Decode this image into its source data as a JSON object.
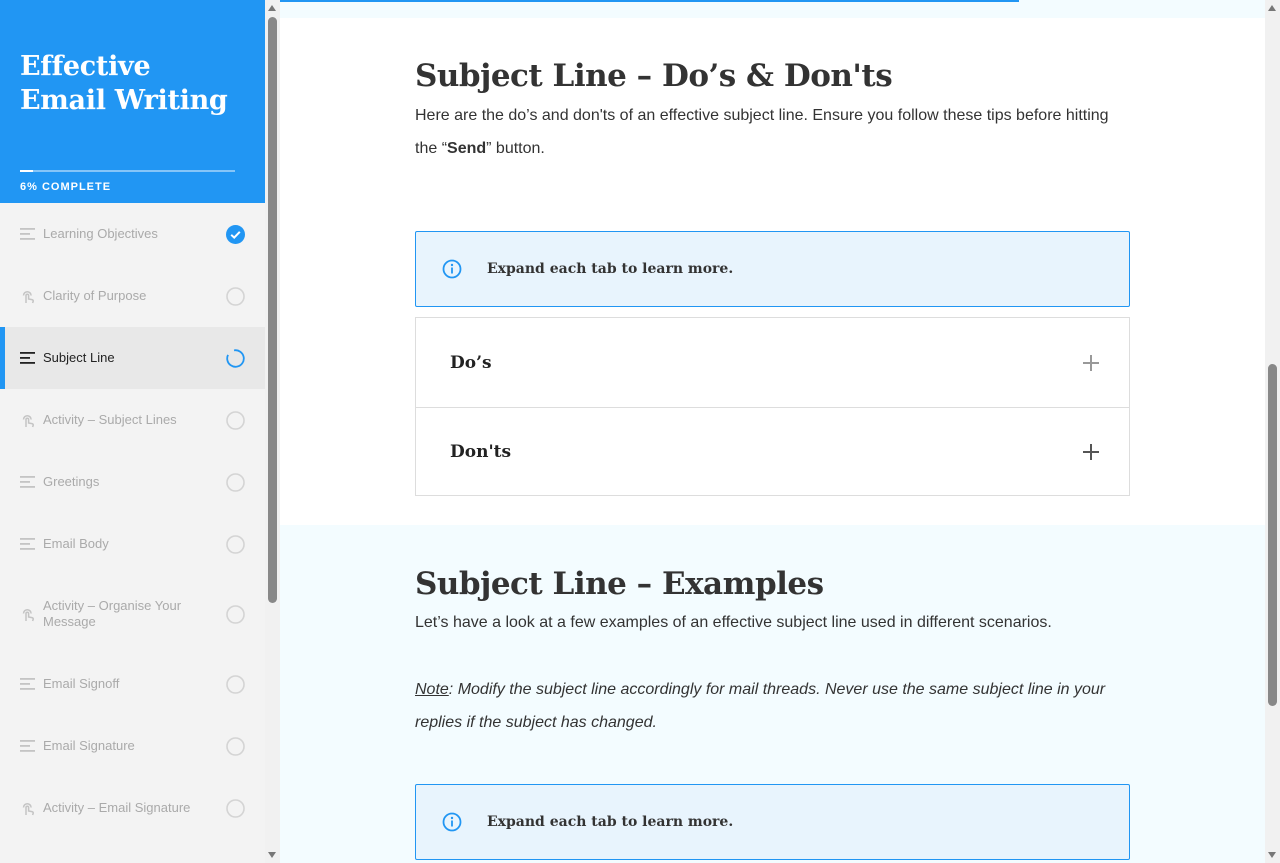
{
  "course": {
    "title": "Effective Email Writing",
    "progress_percent": 6,
    "progress_text": "6% COMPLETE"
  },
  "lessons": [
    {
      "label": "Learning Objectives",
      "type": "text",
      "status": "complete"
    },
    {
      "label": "Clarity of Purpose",
      "type": "activity",
      "status": "incomplete"
    },
    {
      "label": "Subject Line",
      "type": "text",
      "status": "in-progress"
    },
    {
      "label": "Activity – Subject Lines",
      "type": "activity",
      "status": "incomplete"
    },
    {
      "label": "Greetings",
      "type": "text",
      "status": "incomplete"
    },
    {
      "label": "Email Body",
      "type": "text",
      "status": "incomplete"
    },
    {
      "label": "Activity – Organise Your Message",
      "type": "activity",
      "status": "incomplete"
    },
    {
      "label": "Email Signoff",
      "type": "text",
      "status": "incomplete"
    },
    {
      "label": "Email Signature",
      "type": "text",
      "status": "incomplete"
    },
    {
      "label": "Activity – Email Signature",
      "type": "activity",
      "status": "incomplete"
    }
  ],
  "section1": {
    "heading": "Subject Line – Do’s & Don'ts",
    "intro_before": "Here are the do’s and don'ts of an effective subject line. Ensure you follow these tips before hitting the “",
    "intro_bold": "Send",
    "intro_after": "” button.",
    "callout": "Expand each tab to learn more.",
    "accordion": [
      {
        "title": "Do’s"
      },
      {
        "title": "Don'ts"
      }
    ]
  },
  "section2": {
    "heading": "Subject Line – Examples",
    "intro": "Let’s have a look at a few examples of an effective subject line used in different scenarios.",
    "note_label": "Note",
    "note_text": ": Modify the subject line accordingly for mail threads. Never use the same subject line in your replies if the subject has changed.",
    "callout": "Expand each tab to learn more."
  },
  "colors": {
    "accent": "#2196f3",
    "callout_bg": "#e8f4fd"
  }
}
